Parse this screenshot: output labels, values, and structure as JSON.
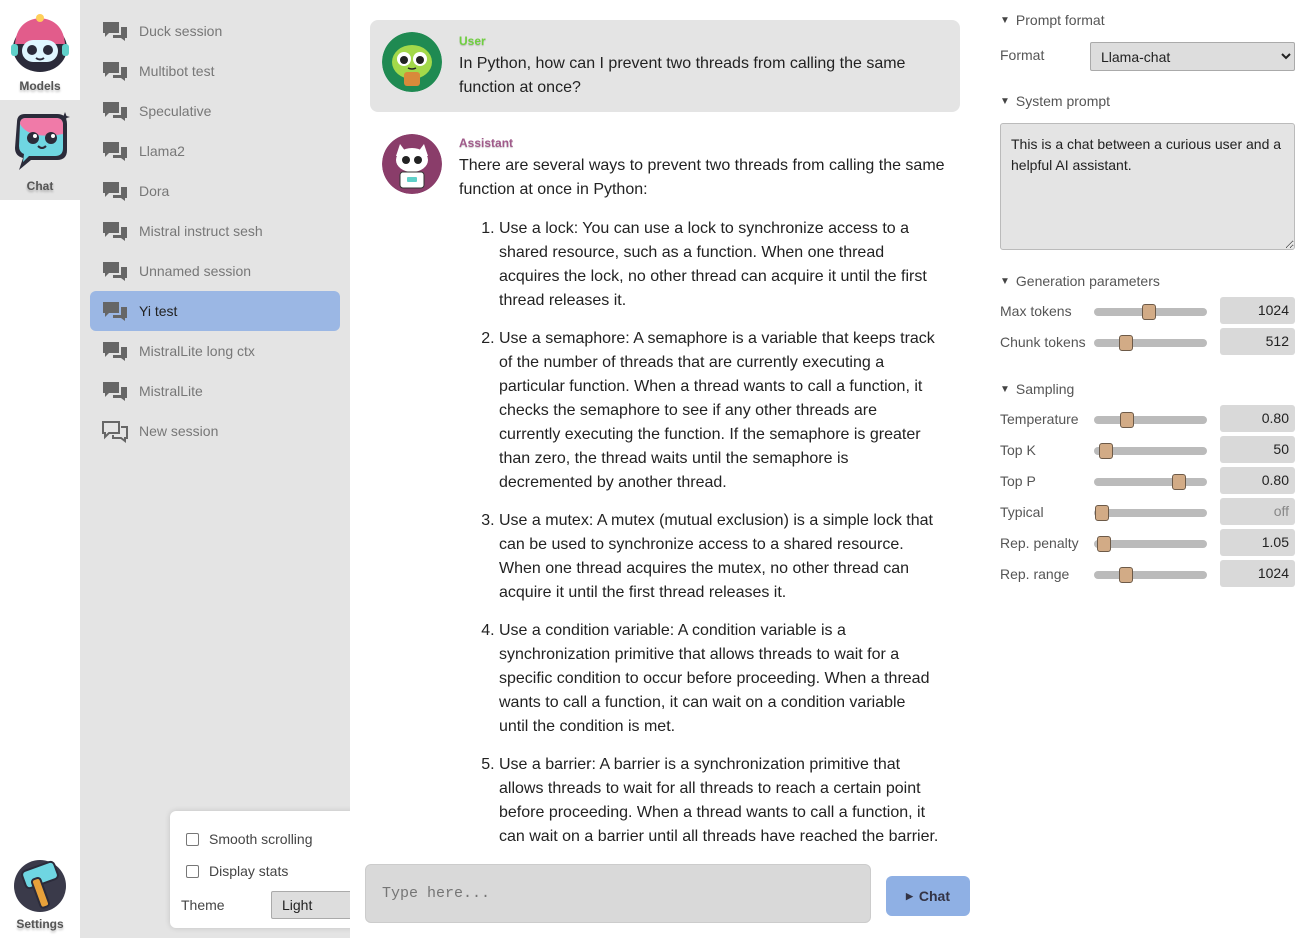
{
  "nav": {
    "items": [
      {
        "label": "Models",
        "icon": "robot-models-icon"
      },
      {
        "label": "Chat",
        "icon": "chat-bubble-icon"
      },
      {
        "label": "Settings",
        "icon": "hammer-icon"
      }
    ]
  },
  "sessions": [
    {
      "label": "Duck session"
    },
    {
      "label": "Multibot test"
    },
    {
      "label": "Speculative"
    },
    {
      "label": "Llama2"
    },
    {
      "label": "Dora"
    },
    {
      "label": "Mistral instruct sesh"
    },
    {
      "label": "Unnamed session"
    },
    {
      "label": "Yi test"
    },
    {
      "label": "MistralLite long ctx"
    },
    {
      "label": "MistralLite"
    },
    {
      "label": "New session"
    }
  ],
  "active_session": "Yi test",
  "settings": {
    "smooth_scrolling": "Smooth scrolling",
    "display_stats": "Display stats",
    "theme_label": "Theme",
    "theme_value": "Light"
  },
  "chat": {
    "user_name": "User",
    "user_text": "In Python, how can I prevent two threads from calling the same function at once?",
    "assistant_name": "Assistant",
    "assistant_intro": "There are several ways to prevent two threads from calling the same function at once in Python:",
    "answer_items": [
      "Use a lock: You can use a lock to synchronize access to a shared resource, such as a function. When one thread acquires the lock, no other thread can acquire it until the first thread releases it.",
      "Use a semaphore: A semaphore is a variable that keeps track of the number of threads that are currently executing a particular function. When a thread wants to call a function, it checks the semaphore to see if any other threads are currently executing the function. If the semaphore is greater than zero, the thread waits until the semaphore is decremented by another thread.",
      "Use a mutex: A mutex (mutual exclusion) is a simple lock that can be used to synchronize access to a shared resource. When one thread acquires the mutex, no other thread can acquire it until the first thread releases it.",
      "Use a condition variable: A condition variable is a synchronization primitive that allows threads to wait for a specific condition to occur before proceeding. When a thread wants to call a function, it can wait on a condition variable until the condition is met.",
      "Use a barrier: A barrier is a synchronization primitive that allows threads to wait for all threads to reach a certain point before proceeding. When a thread wants to call a function, it can wait on a barrier until all threads have reached the barrier."
    ],
    "input_placeholder": "Type here...",
    "send_label": "Chat"
  },
  "params": {
    "prompt_format_title": "Prompt format",
    "format_label": "Format",
    "format_value": "Llama-chat",
    "system_prompt_title": "System prompt",
    "system_prompt": "This is a chat between a curious user and a helpful AI assistant.",
    "generation_title": "Generation parameters",
    "max_tokens_label": "Max tokens",
    "max_tokens": "1024",
    "chunk_tokens_label": "Chunk tokens",
    "chunk_tokens": "512",
    "sampling_title": "Sampling",
    "temperature_label": "Temperature",
    "temperature": "0.80",
    "top_k_label": "Top K",
    "top_k": "50",
    "top_p_label": "Top P",
    "top_p": "0.80",
    "typical_label": "Typical",
    "typical": "off",
    "rep_penalty_label": "Rep. penalty",
    "rep_penalty": "1.05",
    "rep_range_label": "Rep. range",
    "rep_range": "1024",
    "slider_levels": {
      "max_tokens": 0.49,
      "chunk_tokens": 0.28,
      "temperature": 0.29,
      "top_k": 0.11,
      "top_p": 0.75,
      "typical": 0.07,
      "rep_penalty": 0.09,
      "rep_range": 0.28
    }
  },
  "colors": {
    "accent": "#9bb7e4",
    "user_name": "#6fcf3f",
    "assistant_name": "#a05a8a",
    "slider_thumb": "#d2ab86"
  }
}
